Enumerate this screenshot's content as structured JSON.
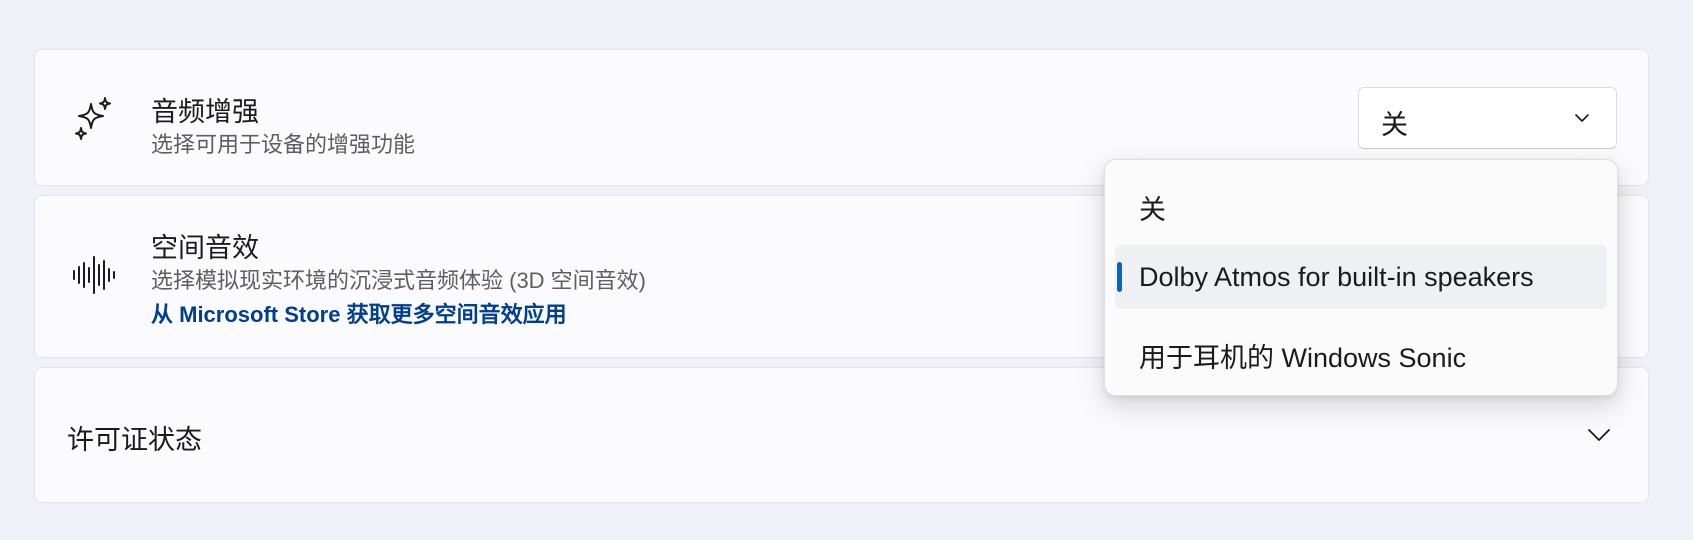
{
  "enhance": {
    "title": "音频增强",
    "description": "选择可用于设备的增强功能",
    "icon": "sparkle-icon",
    "dropdown_value": "关"
  },
  "spatial": {
    "title": "空间音效",
    "description": "选择模拟现实环境的沉浸式音频体验 (3D 空间音效)",
    "link": "从 Microsoft Store 获取更多空间音效应用",
    "icon": "sound-wave-icon"
  },
  "license": {
    "label": "许可证状态"
  },
  "popup": {
    "items": [
      {
        "label": "关",
        "selected": false
      },
      {
        "label": "Dolby Atmos for built-in speakers",
        "selected": true
      },
      {
        "label": "用于耳机的 Windows Sonic",
        "selected": false
      }
    ]
  },
  "colors": {
    "accent": "#0067c0",
    "link": "#003e92",
    "background": "#eef2f8"
  }
}
